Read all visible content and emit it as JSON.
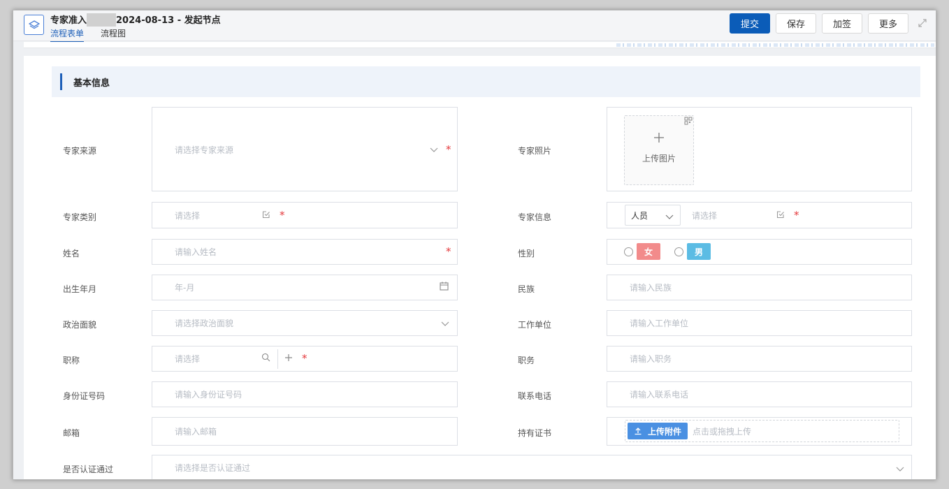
{
  "header": {
    "title_prefix": "专家准入",
    "title_suffix": "2024-08-13 - 发起节点",
    "tabs": [
      {
        "label": "流程表单",
        "active": true
      },
      {
        "label": "流程图",
        "active": false
      }
    ],
    "buttons": {
      "submit": "提交",
      "save": "保存",
      "countersign": "加签",
      "more": "更多"
    },
    "accent_color": "#0b5cb8"
  },
  "section": {
    "title": "基本信息"
  },
  "fields": {
    "expert_source": {
      "label": "专家来源",
      "placeholder": "请选择专家来源",
      "required": true
    },
    "expert_photo": {
      "label": "专家照片",
      "upload_text": "上传图片"
    },
    "expert_category": {
      "label": "专家类别",
      "placeholder": "请选择",
      "required": true
    },
    "expert_info": {
      "label": "专家信息",
      "type_value": "人员",
      "placeholder": "请选择",
      "required": true
    },
    "name": {
      "label": "姓名",
      "placeholder": "请输入姓名",
      "required": true
    },
    "gender": {
      "label": "性别",
      "options": [
        {
          "label": "女",
          "color": "#f28b8b"
        },
        {
          "label": "男",
          "color": "#5bbce4"
        }
      ]
    },
    "birth": {
      "label": "出生年月",
      "placeholder": "年-月"
    },
    "ethnicity": {
      "label": "民族",
      "placeholder": "请输入民族"
    },
    "politics": {
      "label": "政治面貌",
      "placeholder": "请选择政治面貌"
    },
    "workplace": {
      "label": "工作单位",
      "placeholder": "请输入工作单位"
    },
    "title": {
      "label": "职称",
      "placeholder": "请选择",
      "required": true
    },
    "position": {
      "label": "职务",
      "placeholder": "请输入职务"
    },
    "id_number": {
      "label": "身份证号码",
      "placeholder": "请输入身份证号码"
    },
    "phone": {
      "label": "联系电话",
      "placeholder": "请输入联系电话"
    },
    "email": {
      "label": "邮箱",
      "placeholder": "请输入邮箱"
    },
    "certificate": {
      "label": "持有证书",
      "upload_button": "上传附件",
      "hint": "点击或拖拽上传"
    },
    "certified": {
      "label": "是否认证通过",
      "placeholder": "请选择是否认证通过"
    }
  }
}
